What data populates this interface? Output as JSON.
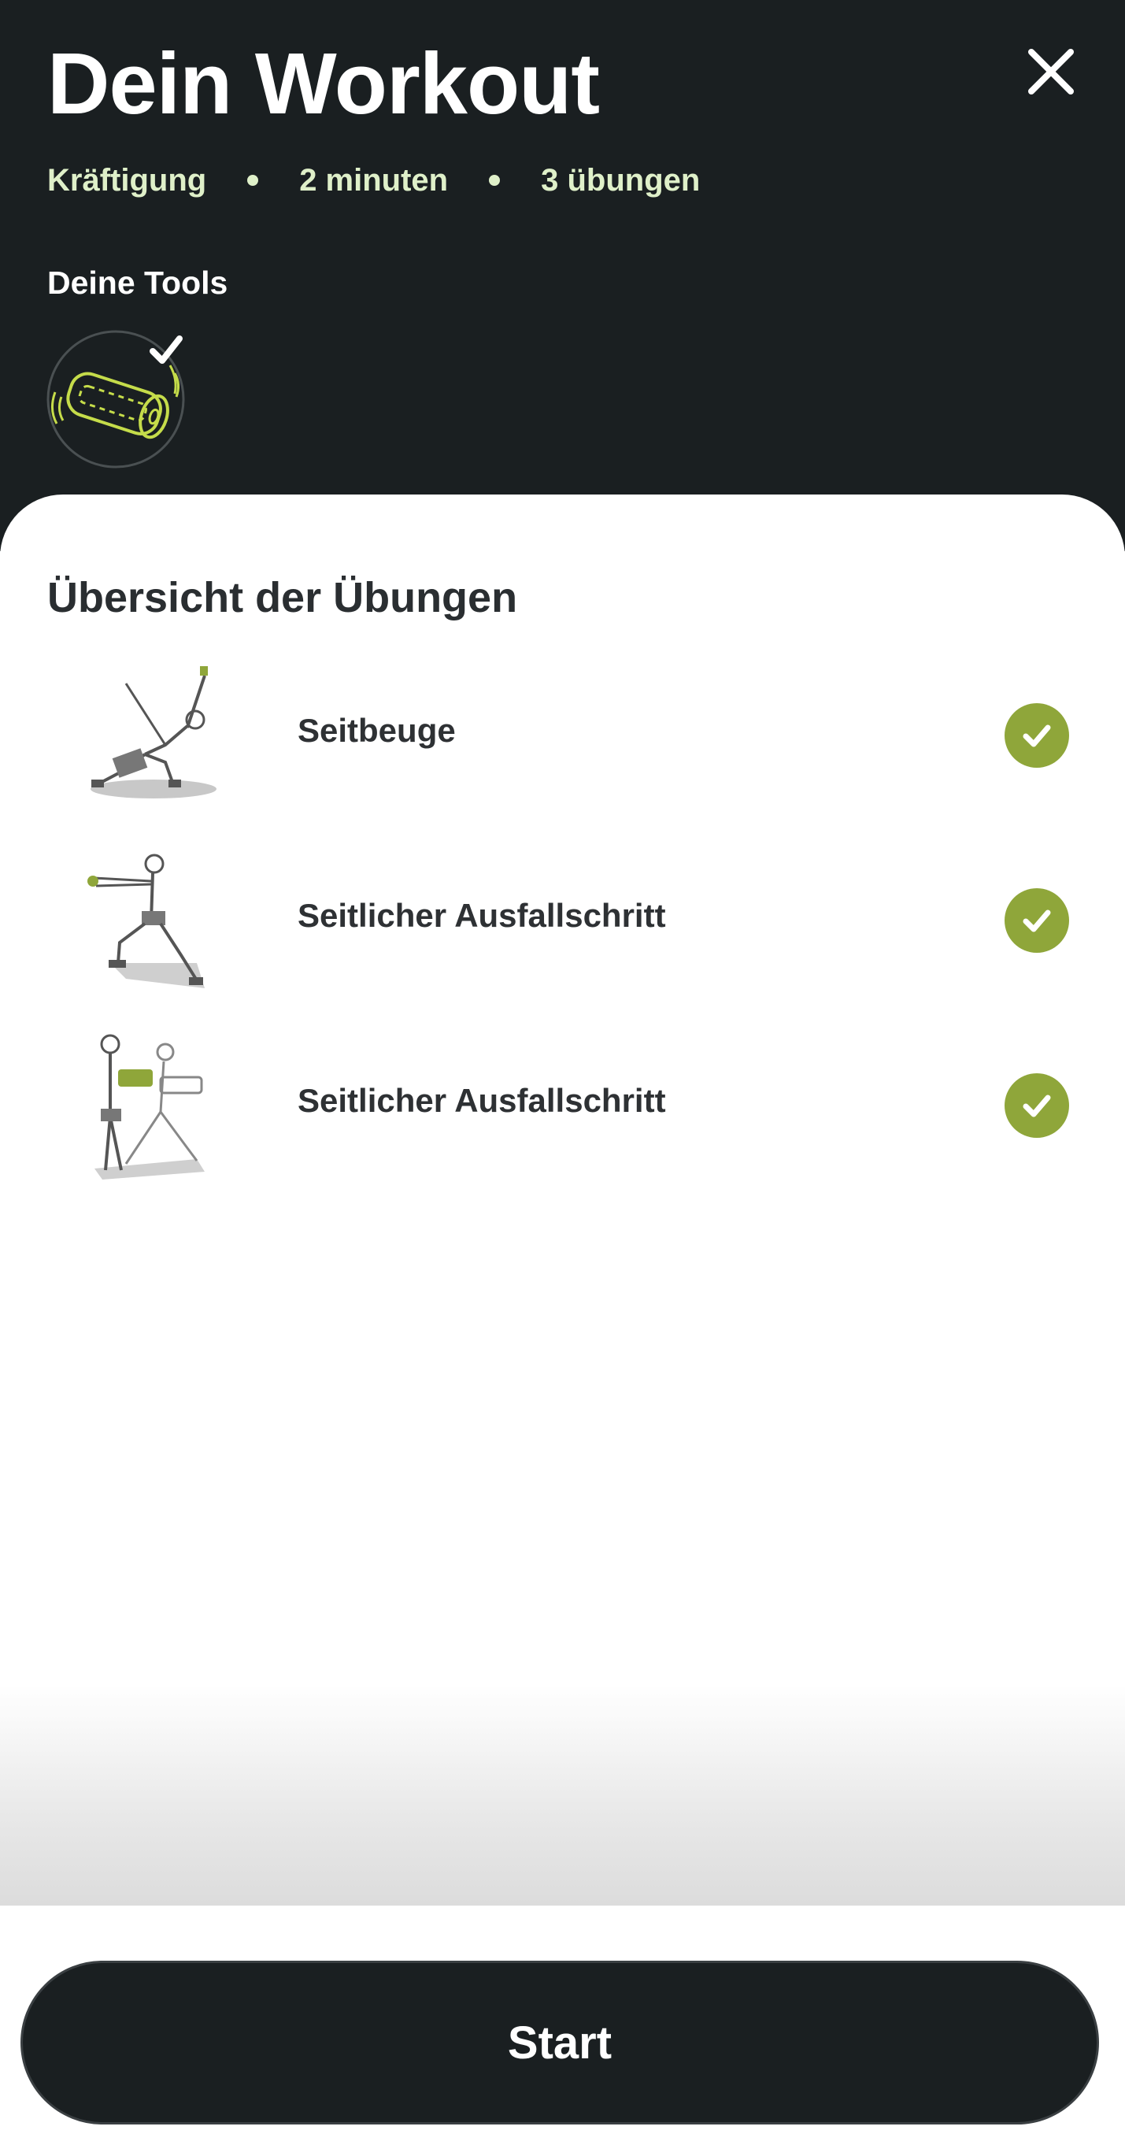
{
  "header": {
    "title": "Dein Workout",
    "meta": {
      "category": "Kräftigung",
      "duration": "2 minuten",
      "count": "3 übungen"
    },
    "tools_label": "Deine Tools",
    "close_icon": "close-icon",
    "tool_icon": "foam-roller-icon"
  },
  "sheet": {
    "title": "Übersicht der Übungen",
    "exercises": [
      {
        "name": "Seitbeuge",
        "status_icon": "check-icon"
      },
      {
        "name": "Seitlicher Ausfallschritt",
        "status_icon": "check-icon"
      },
      {
        "name": "Seitlicher Ausfallschritt",
        "status_icon": "check-icon"
      }
    ]
  },
  "footer": {
    "start_label": "Start"
  },
  "colors": {
    "header_bg": "#1a1f21",
    "accent_green": "#8fa63a",
    "meta_text": "#dff0c9",
    "tool_line": "#c5dc4a"
  }
}
